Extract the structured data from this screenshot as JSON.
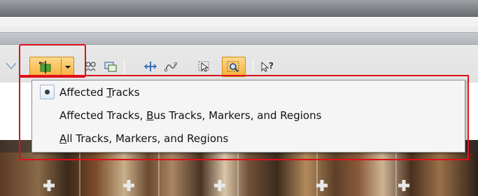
{
  "menu": {
    "items": [
      {
        "pre": "Affected ",
        "ul": "T",
        "post": "racks",
        "selected": true
      },
      {
        "pre": "Affected Tracks, ",
        "ul": "B",
        "post": "us Tracks, Markers, and Regions",
        "selected": false
      },
      {
        "pre": "",
        "ul": "A",
        "post": "ll Tracks, Markers, and Regions",
        "selected": false
      }
    ]
  },
  "toolbar": {
    "icons": [
      "ripple-edit-icon",
      "dropdown-arrow-icon",
      "people-icon",
      "snapshot-icon",
      "split-icon",
      "envelope-icon",
      "selection-icon",
      "zoom-icon",
      "help-pointer-icon"
    ]
  },
  "colors": {
    "highlight_fill": "#f7b13f",
    "highlight_border": "#d28a14",
    "annotation_red": "#e0101a",
    "menu_bg": "#f5f5f5"
  }
}
